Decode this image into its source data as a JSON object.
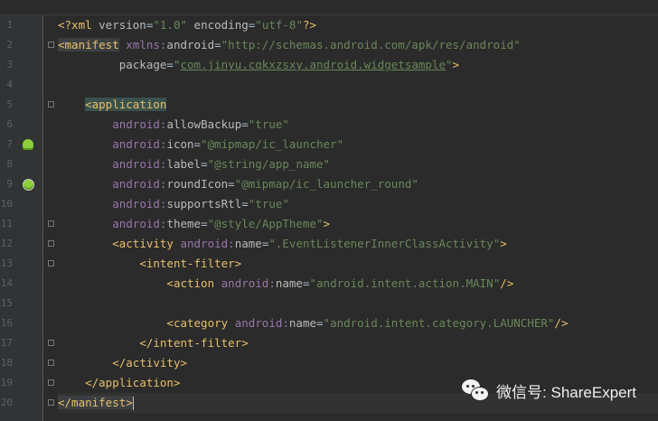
{
  "editor": {
    "line_numbers": [
      "1",
      "2",
      "3",
      "4",
      "5",
      "6",
      "7",
      "8",
      "9",
      "10",
      "11",
      "12",
      "13",
      "14",
      "15",
      "16",
      "17",
      "18",
      "19",
      "20"
    ],
    "lines": [
      {
        "segs": [
          {
            "c": "pi",
            "t": "<?xml "
          },
          {
            "c": "an",
            "t": "version"
          },
          {
            "c": "txt",
            "t": "="
          },
          {
            "c": "av",
            "t": "\"1.0\""
          },
          {
            "c": "txt",
            "t": " "
          },
          {
            "c": "an",
            "t": "encoding"
          },
          {
            "c": "txt",
            "t": "="
          },
          {
            "c": "av",
            "t": "\"utf-8\""
          },
          {
            "c": "pi",
            "t": "?>"
          }
        ]
      },
      {
        "segs": [
          {
            "c": "t hl2",
            "t": "<manifest"
          },
          {
            "c": "txt",
            "t": " "
          },
          {
            "c": "ns",
            "t": "xmlns:"
          },
          {
            "c": "an",
            "t": "android"
          },
          {
            "c": "txt",
            "t": "="
          },
          {
            "c": "av",
            "t": "\"http://schemas.android.com/apk/res/android\""
          }
        ]
      },
      {
        "segs": [
          {
            "c": "ws",
            "t": "         "
          },
          {
            "c": "an",
            "t": "package"
          },
          {
            "c": "txt",
            "t": "="
          },
          {
            "c": "av",
            "t": "\""
          },
          {
            "c": "pkgval",
            "t": "com.jinyu.cqkxzsxy.android.widgetsample"
          },
          {
            "c": "av",
            "t": "\""
          },
          {
            "c": "t",
            "t": ">"
          }
        ]
      },
      {
        "segs": []
      },
      {
        "segs": [
          {
            "c": "ws",
            "t": "    "
          },
          {
            "c": "t hl",
            "t": "<application"
          }
        ]
      },
      {
        "segs": [
          {
            "c": "ws",
            "t": "        "
          },
          {
            "c": "ns",
            "t": "android:"
          },
          {
            "c": "an",
            "t": "allowBackup"
          },
          {
            "c": "txt",
            "t": "="
          },
          {
            "c": "av",
            "t": "\"true\""
          }
        ]
      },
      {
        "segs": [
          {
            "c": "ws",
            "t": "        "
          },
          {
            "c": "ns",
            "t": "android:"
          },
          {
            "c": "an",
            "t": "icon"
          },
          {
            "c": "txt",
            "t": "="
          },
          {
            "c": "av",
            "t": "\"@mipmap/ic_launcher\""
          }
        ]
      },
      {
        "segs": [
          {
            "c": "ws",
            "t": "        "
          },
          {
            "c": "ns",
            "t": "android:"
          },
          {
            "c": "an",
            "t": "label"
          },
          {
            "c": "txt",
            "t": "="
          },
          {
            "c": "av",
            "t": "\"@string/app_name\""
          }
        ]
      },
      {
        "segs": [
          {
            "c": "ws",
            "t": "        "
          },
          {
            "c": "ns",
            "t": "android:"
          },
          {
            "c": "an",
            "t": "roundIcon"
          },
          {
            "c": "txt",
            "t": "="
          },
          {
            "c": "av",
            "t": "\"@mipmap/ic_launcher_round\""
          }
        ]
      },
      {
        "segs": [
          {
            "c": "ws",
            "t": "        "
          },
          {
            "c": "ns",
            "t": "android:"
          },
          {
            "c": "an",
            "t": "supportsRtl"
          },
          {
            "c": "txt",
            "t": "="
          },
          {
            "c": "av",
            "t": "\"true\""
          }
        ]
      },
      {
        "segs": [
          {
            "c": "ws",
            "t": "        "
          },
          {
            "c": "ns",
            "t": "android:"
          },
          {
            "c": "an",
            "t": "theme"
          },
          {
            "c": "txt",
            "t": "="
          },
          {
            "c": "av",
            "t": "\"@style/AppTheme\""
          },
          {
            "c": "t",
            "t": ">"
          }
        ]
      },
      {
        "segs": [
          {
            "c": "ws",
            "t": "        "
          },
          {
            "c": "t",
            "t": "<activity "
          },
          {
            "c": "ns",
            "t": "android:"
          },
          {
            "c": "an",
            "t": "name"
          },
          {
            "c": "txt",
            "t": "="
          },
          {
            "c": "av",
            "t": "\".EventListenerInnerClassActivity\""
          },
          {
            "c": "t",
            "t": ">"
          }
        ]
      },
      {
        "segs": [
          {
            "c": "ws",
            "t": "            "
          },
          {
            "c": "t",
            "t": "<intent-filter>"
          }
        ]
      },
      {
        "segs": [
          {
            "c": "ws",
            "t": "                "
          },
          {
            "c": "t",
            "t": "<action "
          },
          {
            "c": "ns",
            "t": "android:"
          },
          {
            "c": "an",
            "t": "name"
          },
          {
            "c": "txt",
            "t": "="
          },
          {
            "c": "av",
            "t": "\"android.intent.action.MAIN\""
          },
          {
            "c": "t",
            "t": "/>"
          }
        ]
      },
      {
        "segs": []
      },
      {
        "segs": [
          {
            "c": "ws",
            "t": "                "
          },
          {
            "c": "t",
            "t": "<category "
          },
          {
            "c": "ns",
            "t": "android:"
          },
          {
            "c": "an",
            "t": "name"
          },
          {
            "c": "txt",
            "t": "="
          },
          {
            "c": "av",
            "t": "\"android.intent.category.LAUNCHER\""
          },
          {
            "c": "t",
            "t": "/>"
          }
        ]
      },
      {
        "segs": [
          {
            "c": "ws",
            "t": "            "
          },
          {
            "c": "t",
            "t": "</intent-filter>"
          }
        ]
      },
      {
        "segs": [
          {
            "c": "ws",
            "t": "        "
          },
          {
            "c": "t",
            "t": "</activity>"
          }
        ]
      },
      {
        "segs": [
          {
            "c": "ws",
            "t": "    "
          },
          {
            "c": "t",
            "t": "</application>"
          }
        ]
      },
      {
        "segs": [
          {
            "c": "t hl2",
            "t": "</manifest>"
          }
        ]
      }
    ],
    "current_line": 20,
    "gutter_icons": [
      {
        "line": 7,
        "icon": "android-icon"
      },
      {
        "line": 9,
        "icon": "android-round-icon"
      }
    ],
    "fold_markers": [
      2,
      5,
      11,
      12,
      13,
      17,
      18,
      19,
      20
    ]
  },
  "watermark": {
    "icon": "wechat-icon",
    "text": "微信号: ShareExpert"
  }
}
